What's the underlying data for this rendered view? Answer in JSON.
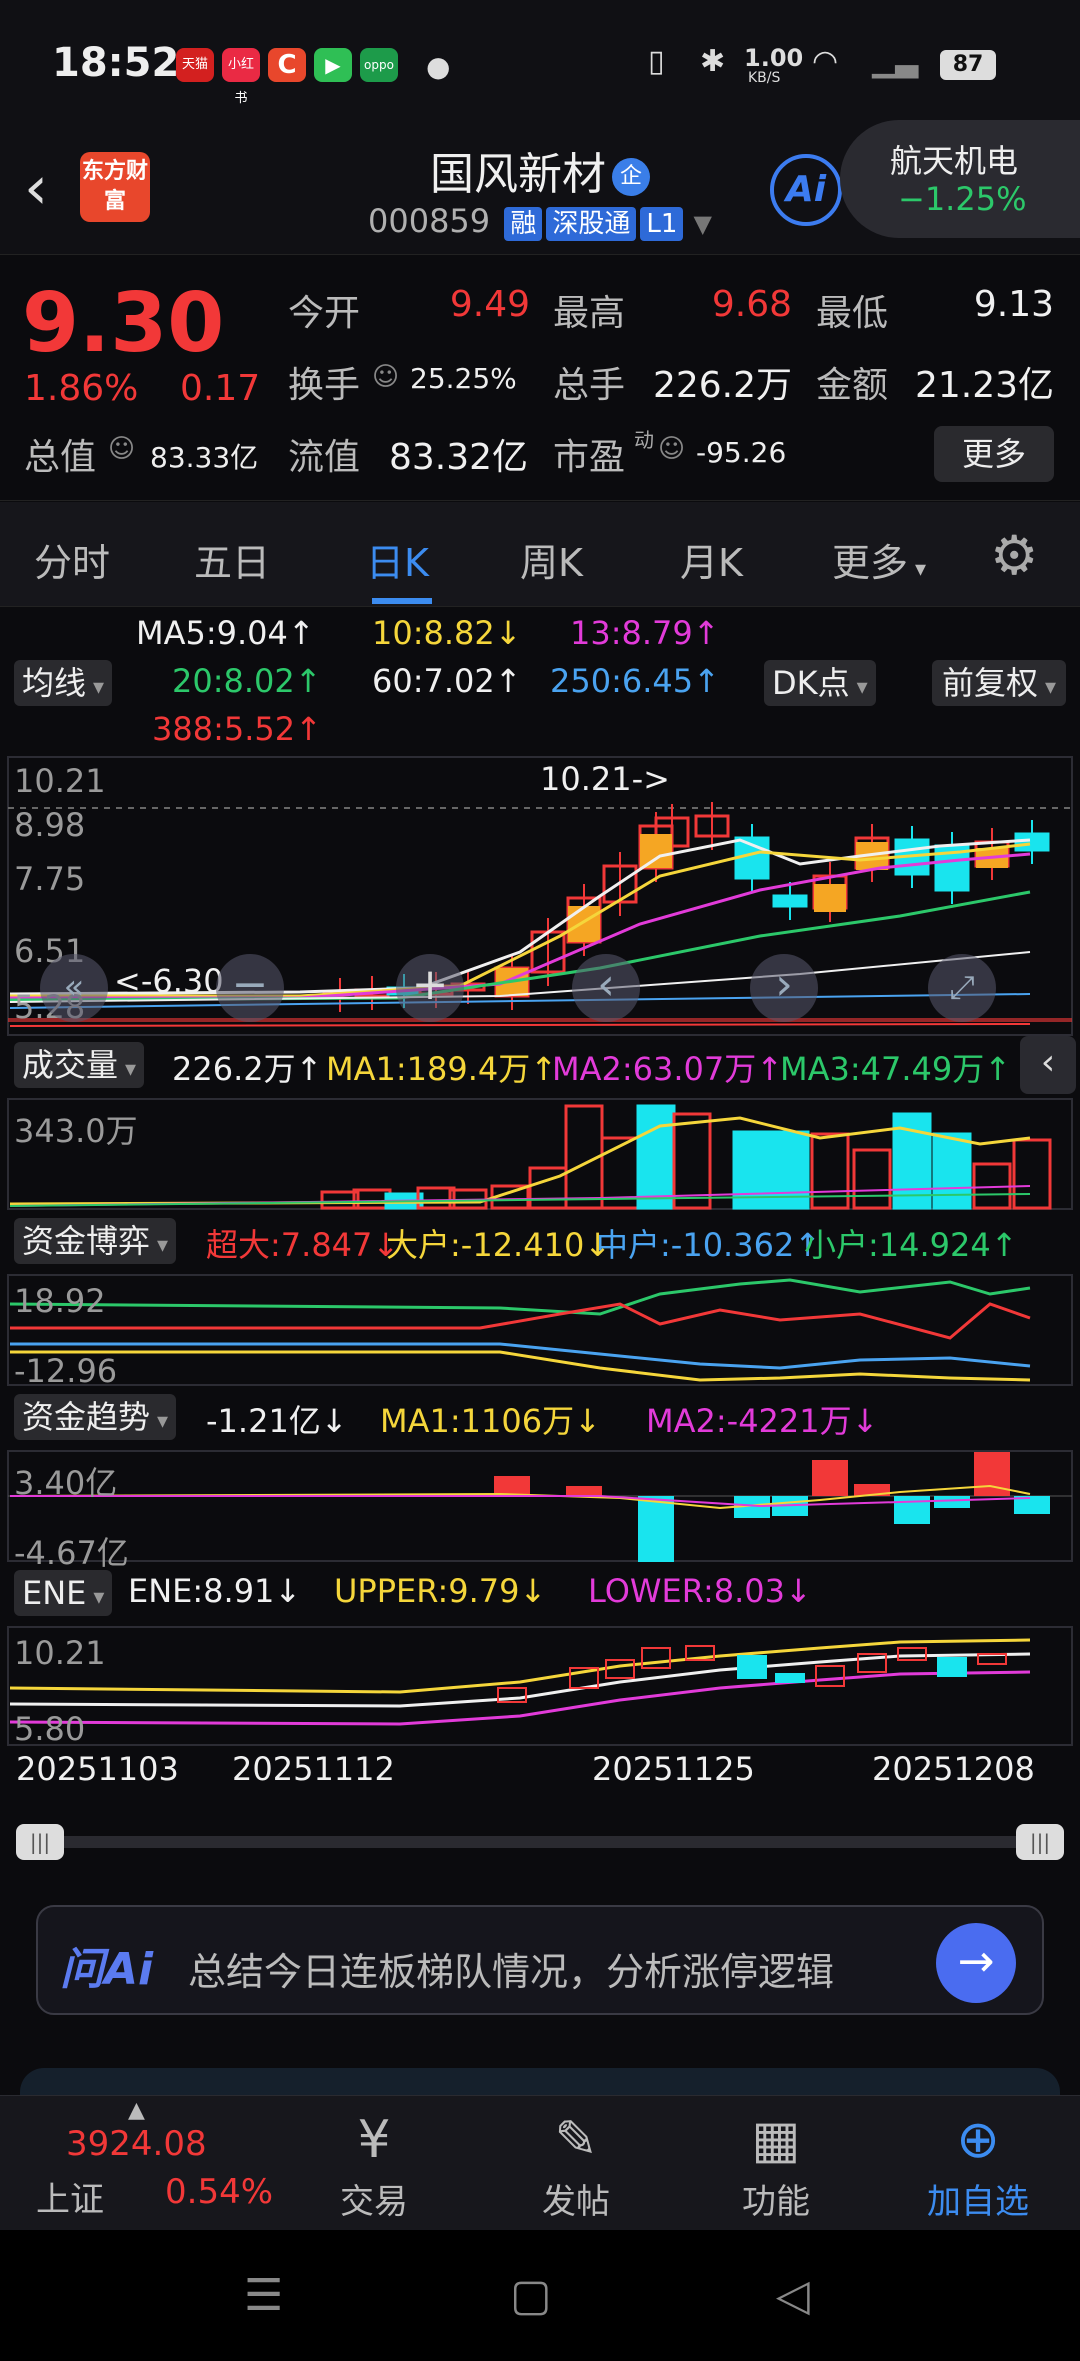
{
  "status_bar": {
    "time": "18:52",
    "apps": [
      "天猫",
      "小红书",
      "C",
      "▶",
      "oppo"
    ],
    "net_speed": "1.00",
    "net_unit": "KB/S",
    "battery": "87"
  },
  "header": {
    "logo": "东方财富",
    "stock_name": "国风新材",
    "badge": "企",
    "code": "000859",
    "tags": [
      "融",
      "深股通",
      "L1"
    ],
    "ai_label": "Ai",
    "peer_name": "航天机电",
    "peer_change": "−1.25%"
  },
  "quote": {
    "price": "9.30",
    "change_pct": "1.86%",
    "change": "0.17",
    "fields": [
      {
        "label": "今开",
        "value": "9.49",
        "color": "#f23838"
      },
      {
        "label": "最高",
        "value": "9.68",
        "color": "#f23838"
      },
      {
        "label": "最低",
        "value": "9.13",
        "color": "#f0f0f0"
      },
      {
        "label": "换手",
        "value": "25.25%",
        "color": "#f0f0f0"
      },
      {
        "label": "总手",
        "value": "226.2万",
        "color": "#f0f0f0"
      },
      {
        "label": "金额",
        "value": "21.23亿",
        "color": "#f0f0f0"
      },
      {
        "label": "总值",
        "value": "83.33亿",
        "color": "#f0f0f0"
      },
      {
        "label": "流值",
        "value": "83.32亿",
        "color": "#f0f0f0"
      },
      {
        "label": "市盈",
        "value": "-95.26",
        "color": "#f0f0f0"
      }
    ],
    "pe_superscript": "动",
    "more": "更多"
  },
  "tabs": {
    "items": [
      "分时",
      "五日",
      "日K",
      "周K",
      "月K",
      "更多"
    ],
    "active": "日K"
  },
  "ma": {
    "selector": "均线",
    "ma5": "MA5:9.04↑",
    "ma10": "10:8.82↓",
    "ma13": "13:8.79↑",
    "ma20": "20:8.02↑",
    "ma60": "60:7.02↑",
    "ma250": "250:6.45↑",
    "ma388": "388:5.52↑",
    "dk": "DK点",
    "adjust": "前复权"
  },
  "kline": {
    "y_labels": [
      "10.21",
      "8.98",
      "7.75",
      "6.51",
      "5.28"
    ],
    "high_marker": "10.21->",
    "low_marker": "<-6.30"
  },
  "volume": {
    "selector": "成交量",
    "value": "226.2万↑",
    "ma1": "MA1:189.4万↑",
    "ma2": "MA2:63.07万↑",
    "ma3": "MA3:47.49万↑",
    "y_label": "343.0万"
  },
  "fund_game": {
    "selector": "资金博弈",
    "super": "超大:7.847↓",
    "big": "大户:-12.410↓",
    "mid": "中户:-10.362↑",
    "small": "小户:14.924↑",
    "y_top": "18.92",
    "y_bot": "-12.96"
  },
  "fund_trend": {
    "selector": "资金趋势",
    "value": "-1.21亿↓",
    "ma1": "MA1:1106万↓",
    "ma2": "MA2:-4221万↓",
    "y_top": "3.40亿",
    "y_bot": "-4.67亿"
  },
  "ene": {
    "selector": "ENE",
    "ene": "ENE:8.91↓",
    "upper": "UPPER:9.79↓",
    "lower": "LOWER:8.03↓",
    "y_top": "10.21",
    "y_bot": "5.80"
  },
  "dates": [
    "20251103",
    "20251112",
    "20251125",
    "20251208"
  ],
  "ask_ai": {
    "logo": "问Ai",
    "prompt": "总结今日连板梯队情况，分析涨停逻辑"
  },
  "bottom_nav": {
    "index_value": "3924.08",
    "index_name": "上证",
    "index_pct": "0.54%",
    "items": [
      {
        "label": "交易",
        "icon": "¥"
      },
      {
        "label": "发帖",
        "icon": "✎"
      },
      {
        "label": "功能",
        "icon": "▦"
      },
      {
        "label": "加自选",
        "icon": "⊕"
      }
    ]
  },
  "colors": {
    "up": "#f23838",
    "down": "#2cc86a",
    "accent": "#3c8cf0",
    "candle_up": "#f23838",
    "candle_down": "#19e4ee"
  }
}
